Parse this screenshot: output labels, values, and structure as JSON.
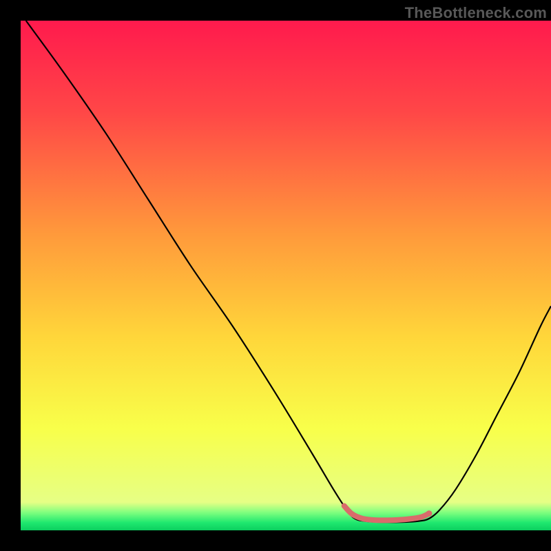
{
  "watermark": "TheBottleneck.com",
  "chart_data": {
    "type": "line",
    "title": "",
    "xlabel": "",
    "ylabel": "",
    "xlim": [
      0,
      100
    ],
    "ylim": [
      0,
      100
    ],
    "gradient_stops": [
      {
        "offset": 0.0,
        "color": "#ff1a4d"
      },
      {
        "offset": 0.18,
        "color": "#ff4747"
      },
      {
        "offset": 0.42,
        "color": "#ff9a3b"
      },
      {
        "offset": 0.62,
        "color": "#ffd63a"
      },
      {
        "offset": 0.8,
        "color": "#f8ff4a"
      },
      {
        "offset": 0.945,
        "color": "#e6ff85"
      },
      {
        "offset": 0.965,
        "color": "#7fff7f"
      },
      {
        "offset": 0.985,
        "color": "#1fe86f"
      },
      {
        "offset": 1.0,
        "color": "#0ccf5f"
      }
    ],
    "series": [
      {
        "name": "bottleneck-curve",
        "color": "#000000",
        "points": [
          {
            "x": 1.0,
            "y": 100.0
          },
          {
            "x": 8.0,
            "y": 90.0
          },
          {
            "x": 16.0,
            "y": 78.0
          },
          {
            "x": 24.0,
            "y": 65.0
          },
          {
            "x": 32.0,
            "y": 52.0
          },
          {
            "x": 40.0,
            "y": 40.0
          },
          {
            "x": 48.0,
            "y": 27.0
          },
          {
            "x": 55.0,
            "y": 15.0
          },
          {
            "x": 59.0,
            "y": 8.0
          },
          {
            "x": 61.5,
            "y": 4.0
          },
          {
            "x": 63.0,
            "y": 2.3
          },
          {
            "x": 65.0,
            "y": 1.8
          },
          {
            "x": 68.0,
            "y": 1.6
          },
          {
            "x": 72.0,
            "y": 1.6
          },
          {
            "x": 75.0,
            "y": 1.8
          },
          {
            "x": 77.0,
            "y": 2.3
          },
          {
            "x": 79.0,
            "y": 4.0
          },
          {
            "x": 82.0,
            "y": 8.0
          },
          {
            "x": 86.0,
            "y": 15.0
          },
          {
            "x": 90.0,
            "y": 23.0
          },
          {
            "x": 94.0,
            "y": 31.0
          },
          {
            "x": 98.0,
            "y": 40.0
          },
          {
            "x": 100.0,
            "y": 44.0
          }
        ]
      },
      {
        "name": "highlight-range",
        "color": "#d96b6b",
        "points": [
          {
            "x": 61.0,
            "y": 4.8
          },
          {
            "x": 62.5,
            "y": 3.2
          },
          {
            "x": 64.5,
            "y": 2.3
          },
          {
            "x": 67.0,
            "y": 2.0
          },
          {
            "x": 70.0,
            "y": 2.0
          },
          {
            "x": 73.0,
            "y": 2.2
          },
          {
            "x": 75.5,
            "y": 2.6
          },
          {
            "x": 77.0,
            "y": 3.3
          }
        ],
        "end_marker": {
          "x": 77.0,
          "y": 3.3,
          "r": 4.5
        }
      }
    ]
  }
}
